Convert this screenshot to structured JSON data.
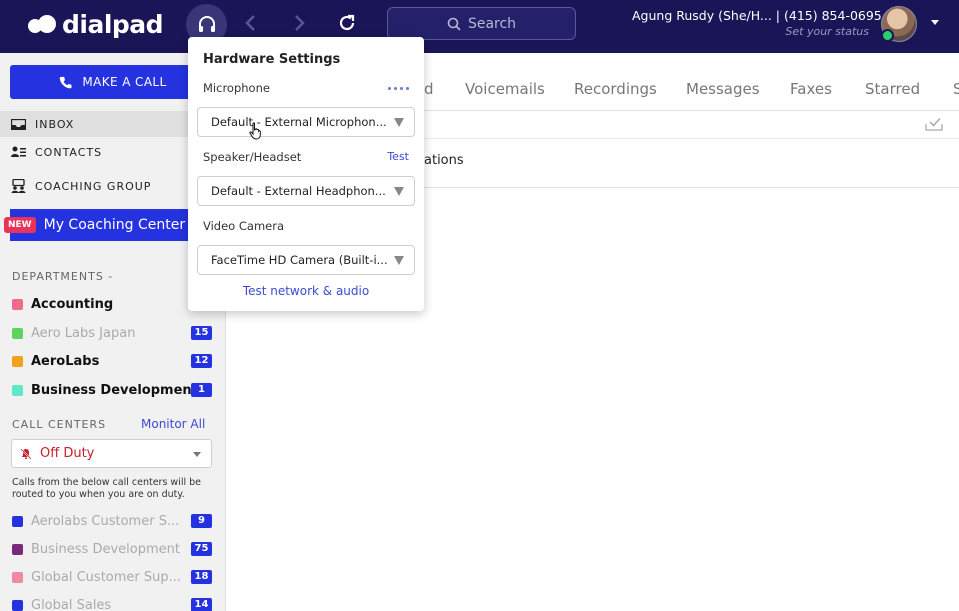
{
  "app": {
    "logo_text": "dialpad"
  },
  "header": {
    "search_label": "Search",
    "user_name": "Agung Rusdy (She/H... | (415) 854-0695",
    "user_status": "Set your status"
  },
  "sidebar": {
    "make_call": "MAKE A CALL",
    "nav": [
      {
        "label": "INBOX",
        "icon": "inbox-icon",
        "active": true
      },
      {
        "label": "CONTACTS",
        "icon": "contacts-icon",
        "active": false
      },
      {
        "label": "COACHING GROUP",
        "icon": "coaching-group-icon",
        "active": false
      }
    ],
    "coaching": {
      "badge": "NEW",
      "label": "My Coaching Center"
    },
    "departments_label": "DEPARTMENTS  -",
    "departments": [
      {
        "name": "Accounting",
        "color": "#f06b8a",
        "badge": "",
        "dim": false
      },
      {
        "name": "Aero Labs Japan",
        "color": "#5fd35f",
        "badge": "15",
        "dim": true
      },
      {
        "name": "AeroLabs",
        "color": "#f2a01e",
        "badge": "12",
        "dim": false
      },
      {
        "name": "Business Development",
        "color": "#5fe8c8",
        "badge": "1",
        "dim": false
      }
    ],
    "call_centers_label": "CALL CENTERS",
    "monitor_all": "Monitor All",
    "duty_status": "Off Duty",
    "duty_note": "Calls from the below call centers will be routed to you when you are on duty.",
    "call_centers": [
      {
        "name": "Aerolabs Customer S...",
        "color": "#2432e0",
        "badge": "9"
      },
      {
        "name": "Business Development",
        "color": "#7a2a7a",
        "badge": "75"
      },
      {
        "name": "Global Customer Sup...",
        "color": "#f08aa0",
        "badge": "18"
      },
      {
        "name": "Global Sales",
        "color": "#2432e0",
        "badge": "14"
      }
    ]
  },
  "main": {
    "tabs": [
      "d",
      "Voicemails",
      "Recordings",
      "Messages",
      "Faxes",
      "Starred",
      "S"
    ],
    "notifications_text": "ations"
  },
  "hardware": {
    "title": "Hardware Settings",
    "microphone_label": "Microphone",
    "microphone_value": "Default - External Microphon...",
    "speaker_label": "Speaker/Headset",
    "speaker_test": "Test",
    "speaker_value": "Default - External Headphon...",
    "camera_label": "Video Camera",
    "camera_value": "FaceTime HD Camera (Built-i...",
    "test_link": "Test network & audio"
  },
  "colors": {
    "brand_navy": "#1a1556",
    "accent_blue": "#2432e0",
    "alert_red": "#c51f2a"
  }
}
